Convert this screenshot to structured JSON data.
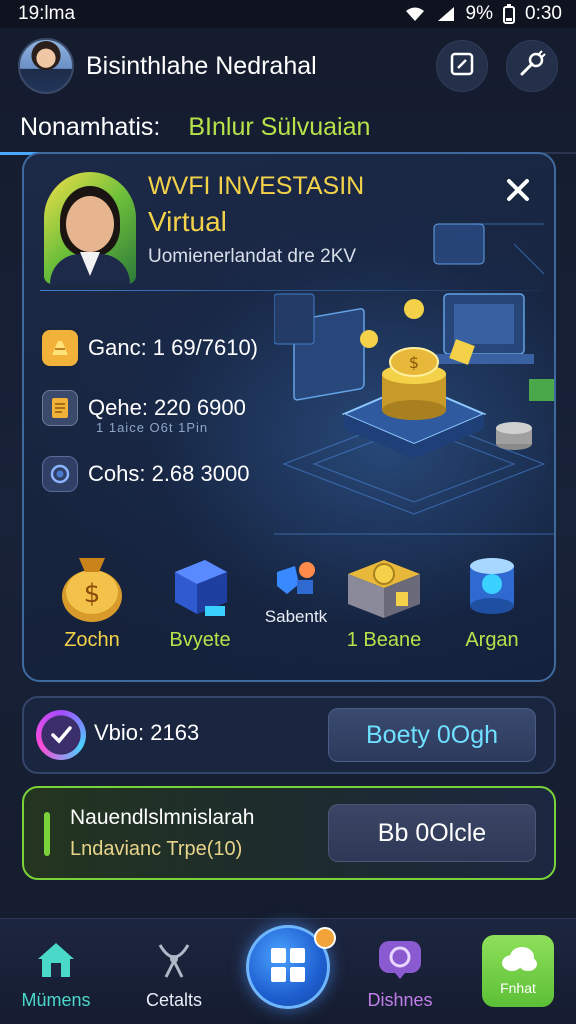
{
  "status_bar": {
    "time_left": "19:lma",
    "battery": "9%",
    "time_right": "0:30"
  },
  "header": {
    "user_name": "Bisinthlahe Nedrahal"
  },
  "sub_header": {
    "label": "Nonamhatis:",
    "value": "BInlur Sülvuaian"
  },
  "card": {
    "title_line1": "WVFI INVESTASIN",
    "title_line2": "Virtual",
    "subtitle": "Uomienerlandat dre 2KV",
    "stats": [
      {
        "icon": "gold-bars-icon",
        "text": "Ganc: 1 69/7610)"
      },
      {
        "icon": "document-icon",
        "text": "Qehe: 220 6900"
      },
      {
        "icon": "coin-icon",
        "text": "Cohs: 2.68 3000"
      }
    ],
    "stat_note": "1 1aice O6t 1Pin",
    "items": [
      {
        "label": "Zochn",
        "color": "#f3d24a"
      },
      {
        "label": "Bvyete",
        "color": "#b6e24a"
      },
      {
        "label": "Sabentk",
        "color": "#e8edf5"
      },
      {
        "label": "1 Beane",
        "color": "#b6e24a"
      },
      {
        "label": "Argan",
        "color": "#b6e24a"
      }
    ]
  },
  "video_bar": {
    "label": "Vbio: 2163",
    "button": "Boety 0Ogh"
  },
  "promo_bar": {
    "title": "Nauendlslmnislarah",
    "subtitle": "Lndavianc Trpe(10)",
    "button": "Bb 0Olcle"
  },
  "bottom_nav": [
    {
      "label": "Mümens",
      "color": "#4ad8c8"
    },
    {
      "label": "Cetalts",
      "color": "#e8edf5"
    },
    {
      "label": "Dishnes",
      "color": "#c07ee8"
    },
    {
      "label": "Fnhat",
      "color": "#ffffff"
    }
  ],
  "colors": {
    "accent_yellow": "#f3d24a",
    "accent_green": "#b6e24a",
    "accent_cyan": "#6fe0ff",
    "border_blue": "#3f6aa0"
  }
}
